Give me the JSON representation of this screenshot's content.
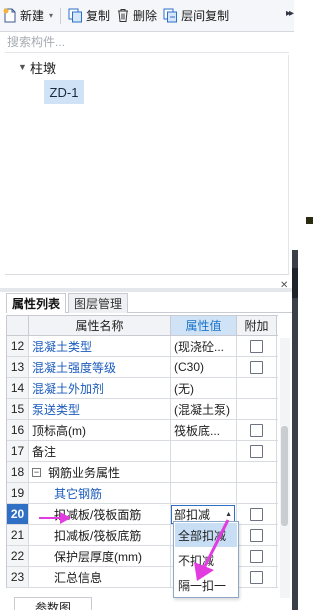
{
  "toolbar": {
    "new_label": "新建",
    "copy_label": "复制",
    "delete_label": "删除",
    "floor_copy_label": "层间复制",
    "more_glyph": "▸▸"
  },
  "search": {
    "placeholder": "搜索构件..."
  },
  "tree": {
    "root_label": "柱墩",
    "child_label": "ZD-1"
  },
  "tabs": {
    "props": "属性列表",
    "layers": "图层管理"
  },
  "grid": {
    "headers": {
      "name": "属性名称",
      "value": "属性值",
      "add": "附加"
    },
    "rows": [
      {
        "num": "12",
        "name": "混凝土类型",
        "value": "(现浇砼...",
        "check": true
      },
      {
        "num": "13",
        "name": "混凝土强度等级",
        "value": "(C30)",
        "check": true
      },
      {
        "num": "14",
        "name": "混凝土外加剂",
        "value": "(无)",
        "check": false
      },
      {
        "num": "15",
        "name": "泵送类型",
        "value": "(混凝土泵)",
        "check": false
      },
      {
        "num": "16",
        "name": "顶标高(m)",
        "value": "筏板底...",
        "check": true
      },
      {
        "num": "17",
        "name": "备注",
        "value": "",
        "check": true
      },
      {
        "num": "18",
        "name": "钢筋业务属性",
        "value": "",
        "check": false
      },
      {
        "num": "19",
        "name": "其它钢筋",
        "value": "",
        "check": false
      },
      {
        "num": "20",
        "name": "扣减板/筏板面筋",
        "value": "部扣减",
        "check": true
      },
      {
        "num": "21",
        "name": "扣减板/筏板底筋",
        "value": "",
        "check": true
      },
      {
        "num": "22",
        "name": "保护层厚度(mm)",
        "value": "",
        "check": true
      },
      {
        "num": "23",
        "name": "汇总信息",
        "value": "",
        "check": true
      }
    ]
  },
  "dropdown": {
    "options": [
      "全部扣减",
      "不扣减",
      "隔一扣一"
    ]
  },
  "bottom": {
    "tab_label": "参数图"
  },
  "colors": {
    "accent": "#1a73c9",
    "selected_row": "#2f6fc4",
    "annotation": "#e23be0"
  }
}
